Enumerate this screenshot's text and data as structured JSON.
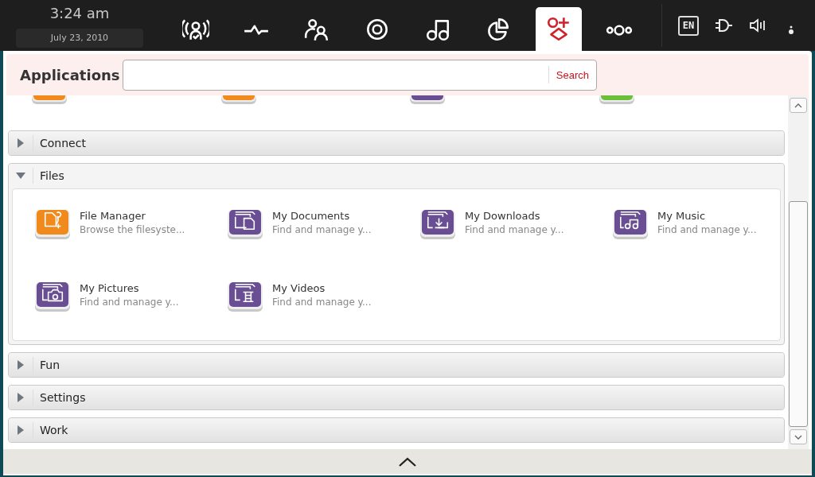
{
  "clock": {
    "time": "3:24 am",
    "date": "July 23, 2010"
  },
  "nav": [
    {
      "kind": "status",
      "selected": false
    },
    {
      "kind": "activity",
      "selected": false
    },
    {
      "kind": "people",
      "selected": false
    },
    {
      "kind": "target",
      "selected": false
    },
    {
      "kind": "music",
      "selected": false
    },
    {
      "kind": "pie",
      "selected": false
    },
    {
      "kind": "apps",
      "selected": true
    },
    {
      "kind": "more",
      "selected": false
    }
  ],
  "tray": {
    "language": "EN"
  },
  "header": {
    "title": "Applications",
    "search": {
      "button": "Search"
    }
  },
  "partial_row": [
    {
      "color": "#f08a1c"
    },
    {
      "color": "#f08a1c"
    },
    {
      "color": "#6a4e93"
    },
    {
      "color": "#6bbf3a"
    }
  ],
  "categories": [
    {
      "label": "Connect",
      "expanded": false
    },
    {
      "label": "Files",
      "expanded": true,
      "items": [
        {
          "kind": "file-manager",
          "name": "File Manager",
          "description": "Browse the filesyste..."
        },
        {
          "kind": "documents",
          "name": "My Documents",
          "description": "Find and manage y..."
        },
        {
          "kind": "downloads",
          "name": "My Downloads",
          "description": "Find and manage y..."
        },
        {
          "kind": "music",
          "name": "My Music",
          "description": "Find and manage y..."
        },
        {
          "kind": "pictures",
          "name": "My Pictures",
          "description": "Find and manage y..."
        },
        {
          "kind": "videos",
          "name": "My Videos",
          "description": "Find and manage y..."
        }
      ]
    },
    {
      "label": "Fun",
      "expanded": false
    },
    {
      "label": "Settings",
      "expanded": false
    },
    {
      "label": "Work",
      "expanded": false
    }
  ]
}
